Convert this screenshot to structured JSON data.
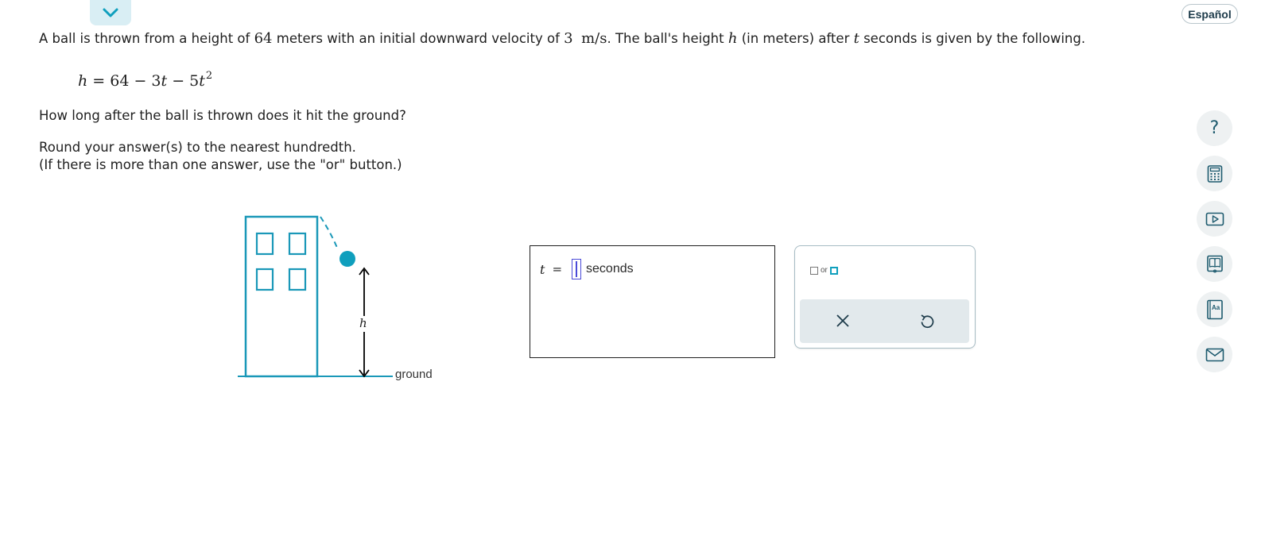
{
  "header": {
    "collapse_icon": "chevron-down-icon",
    "language_label": "Español"
  },
  "problem": {
    "line1": {
      "p1": "A ball is thrown from a height of ",
      "height": "64",
      "p2": " meters with an initial downward velocity of ",
      "velocity": "3",
      "unit": "m/s",
      "p3": ". The ball's height ",
      "var_h": "h",
      "p4": " (in meters) after ",
      "var_t": "t",
      "p5": " seconds is given by the following."
    },
    "equation": {
      "lhs": "h",
      "rhs_part1": " = 64 − 3",
      "t1": "t",
      "rhs_part2": " − 5",
      "t2": "t",
      "exponent": "2"
    },
    "question": "How long after the ball is thrown does it hit the ground?",
    "instruction1": "Round your answer(s) to the nearest hundredth.",
    "instruction2": "(If there is more than one answer, use the \"or\" button.)"
  },
  "figure": {
    "height_label": "h",
    "ground_label": "ground",
    "building_color": "#1a98b8",
    "ball_color": "#0f9fbd"
  },
  "answer": {
    "variable": "t",
    "equals": "=",
    "value": "",
    "unit": "seconds"
  },
  "palette": {
    "or_label": "or",
    "clear_icon": "close-icon",
    "undo_icon": "undo-icon"
  },
  "sidebar": {
    "help_glyph": "?",
    "items": [
      "help-icon",
      "calculator-icon",
      "video-icon",
      "textbook-icon",
      "glossary-icon",
      "message-icon"
    ],
    "glossary_glyph": "Aa"
  },
  "colors": {
    "accent": "#0f9fbd",
    "collapse_bg": "#d9eef4",
    "icon_dark": "#1d5a6e"
  }
}
